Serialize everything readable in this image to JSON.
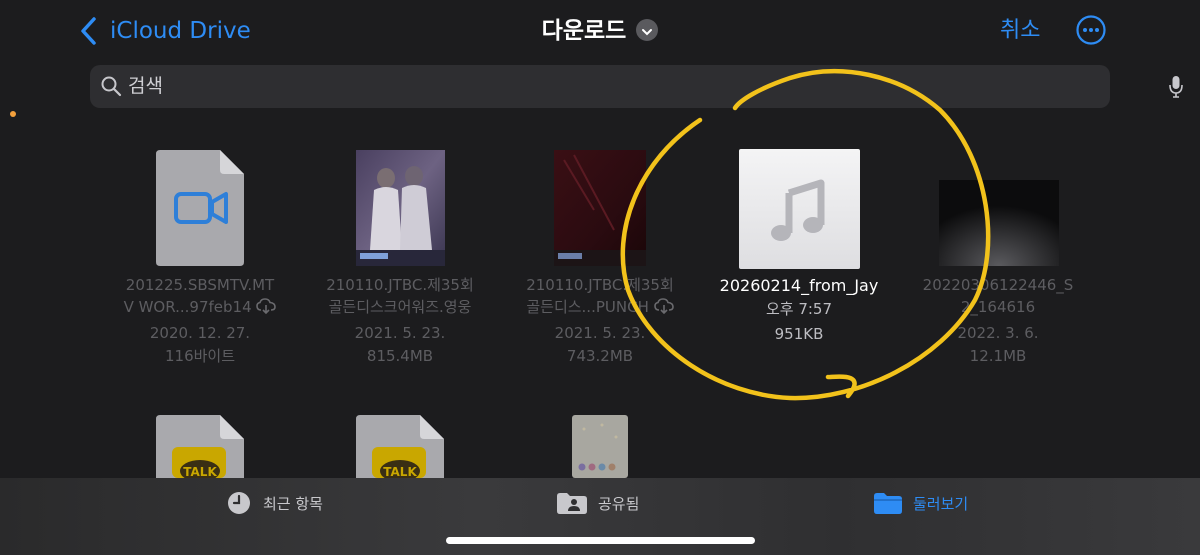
{
  "nav": {
    "back_label": "iCloud Drive",
    "title": "다운로드",
    "cancel_label": "취소"
  },
  "search": {
    "placeholder": "검색"
  },
  "files": [
    {
      "name_line1": "201225.SBSMTV.MT",
      "name_line2": "V WOR...97feb14",
      "date": "2020. 12. 27.",
      "size": "116바이트",
      "cloud": true
    },
    {
      "name_line1": "210110.JTBC.제35회",
      "name_line2": "골든디스크어워즈.영웅",
      "date": "2021. 5. 23.",
      "size": "815.4MB",
      "cloud": false
    },
    {
      "name_line1": "210110.JTBC.제35회",
      "name_line2": "골든디스...PUNCH",
      "date": "2021. 5. 23.",
      "size": "743.2MB",
      "cloud": true
    },
    {
      "name_line1": "20260214_from_Jay",
      "name_line2": "",
      "date": "오후 7:57",
      "size": "951KB",
      "cloud": false
    },
    {
      "name_line1": "20220306122446_S",
      "name_line2": "2_164616",
      "date": "2022. 3. 6.",
      "size": "12.1MB",
      "cloud": false
    }
  ],
  "kakao_label": "TALK",
  "tabs": [
    {
      "label": "최근 항목",
      "icon": "clock-icon"
    },
    {
      "label": "공유됨",
      "icon": "shared-folder-icon"
    },
    {
      "label": "둘러보기",
      "icon": "folder-icon",
      "active": true
    }
  ],
  "colors": {
    "accent": "#2e8cf4",
    "highlight": "#f2c21b",
    "background": "#1c1c1e"
  }
}
